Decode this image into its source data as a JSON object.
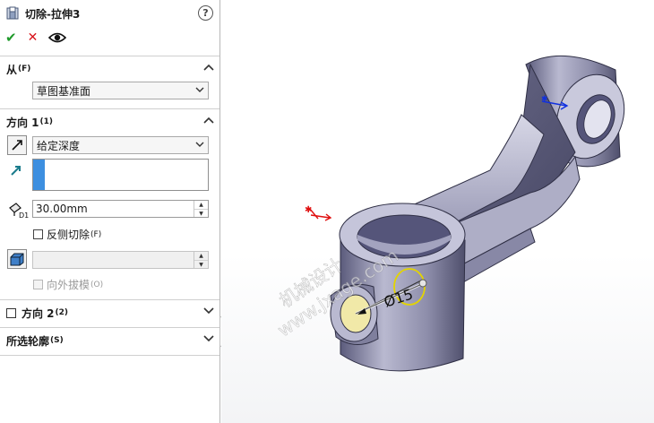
{
  "panel": {
    "title": "切除-拉伸3",
    "help": "?",
    "actions": {
      "ok": "✔",
      "cancel": "✕"
    },
    "from_section": {
      "label": "从",
      "key": "(F)",
      "value": "草图基准面"
    },
    "direction1_section": {
      "label": "方向 1",
      "key": "(1)",
      "end_condition": "给定深度",
      "depth": "30.00mm",
      "flip_side": {
        "label": "反侧切除",
        "key": "(F)",
        "checked": false
      },
      "draft_value": "",
      "draft_outward": {
        "label": "向外拔模",
        "key": "(O)",
        "checked": false
      }
    },
    "direction2_section": {
      "label": "方向 2",
      "key": "(2)",
      "checked": false
    },
    "selected_contours": {
      "label": "所选轮廓",
      "key": "(S)"
    }
  },
  "viewport": {
    "dimension_label": "Ø15",
    "watermark_line1": "机械设计",
    "watermark_line2": "www.jxage.com"
  },
  "colors": {
    "part_body": "#7a7a98",
    "part_highlight": "#c9c9dc",
    "part_shadow": "#4a4a66",
    "sketch_circle": "#f1e9a8",
    "sketch_outline": "#e3d400",
    "axis_red": "#e01010",
    "axis_blue": "#1030e0",
    "ok_green": "#1f9a2b",
    "cancel_red": "#d8141b",
    "accent_blue": "#3d8fe0"
  }
}
